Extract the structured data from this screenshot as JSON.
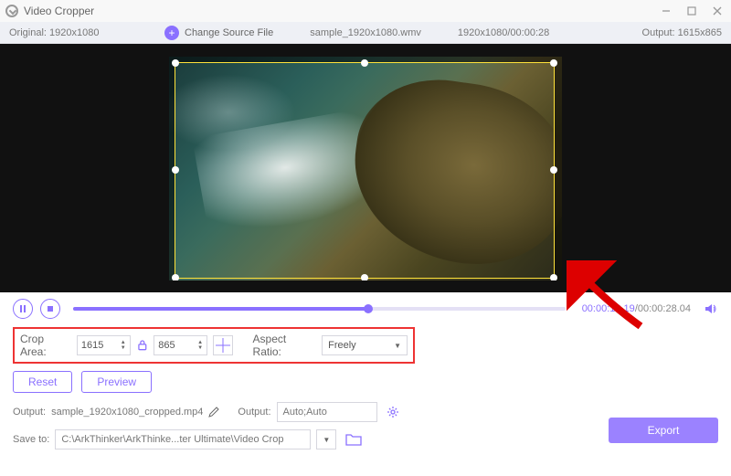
{
  "titlebar": {
    "title": "Video Cropper"
  },
  "infobar": {
    "original_label": "Original:",
    "original_value": "1920x1080",
    "change_label": "Change Source File",
    "filename": "sample_1920x1080.wmv",
    "duration": "1920x1080/00:00:28",
    "output_label": "Output:",
    "output_value": "1615x865"
  },
  "playback": {
    "current": "00:00:18.19",
    "total": "00:00:28.04",
    "progress_pct": 60
  },
  "crop": {
    "area_label": "Crop Area:",
    "width": "1615",
    "height": "865",
    "aspect_label": "Aspect Ratio:",
    "aspect_value": "Freely"
  },
  "actions": {
    "reset": "Reset",
    "preview": "Preview"
  },
  "output": {
    "label1": "Output:",
    "filename": "sample_1920x1080_cropped.mp4",
    "label2": "Output:",
    "mode": "Auto;Auto"
  },
  "save": {
    "label": "Save to:",
    "path": "C:\\ArkThinker\\ArkThinke...ter Ultimate\\Video Crop"
  },
  "export": {
    "label": "Export"
  }
}
